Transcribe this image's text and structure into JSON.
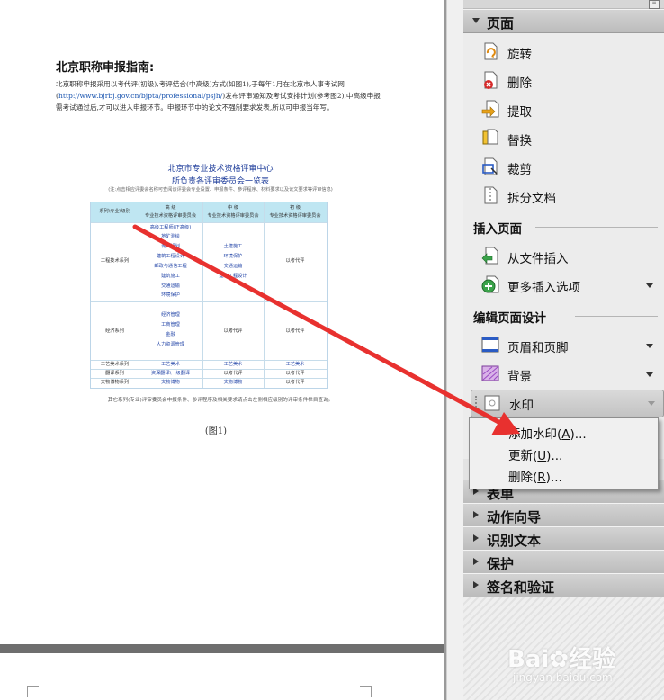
{
  "document": {
    "heading": "北京职称申报指南:",
    "para_1": "北京职称申报采用以考代评(初级),考评结合(中高级)方式(如图1),于每年1月在北京市人事考试网(",
    "para_link": "http://www.bjrbj.gov.cn/bjpta/professional/psjh/",
    "para_2": ")发布评审通知及考试安排计划(参考图2),中高级申报需考试通过后,才可以进入申报环节。申报环节中的论文不强制要求发表,所以可申报当年写。",
    "table_title_1": "北京市专业技术资格评审中心",
    "table_title_2": "所负责各评审委员会一览表",
    "table_note": "(注:点击相应评委会名称可查阅该评委会专业设置、申报条件、参评程序、材料要求以及论文要求等评审信息)",
    "table": {
      "h_col1": "系列\\专业\\级别",
      "h_col2_a": "高    级",
      "h_col2_b": "专业技术资格评审委员会",
      "h_col3_a": "中    级",
      "h_col3_b": "专业技术资格评审委员会",
      "h_col4_a": "初    级",
      "h_col4_b": "专业技术资格评审委员会",
      "row1_series": "工程技术系列",
      "row1_senior": [
        "高级工程师(正高级)",
        "地矿测绘",
        "城乡规划",
        "建筑工程设计",
        "邮政与通信工程",
        "建筑施工",
        "交通运输",
        "环境保护"
      ],
      "row1_mid": [
        "土建施工",
        "环境保护",
        "交通运输",
        "建筑工程设计"
      ],
      "row1_junior": "以考代评",
      "row2_series": "经济系列",
      "row2_senior": [
        "经济管理",
        "工商管理",
        "金融",
        "人力资源管理"
      ],
      "row2_mid": "以考代评",
      "row2_junior": "以考代评",
      "row3_series": "工艺美术系列",
      "row3_senior": "工艺美术",
      "row3_mid": "工艺美术",
      "row3_junior": "工艺美术",
      "row4_series": "翻译系列",
      "row4_senior": "资深翻译\\一级翻译",
      "row4_mid": "以考代评",
      "row4_junior": "以考代评",
      "row5_series": "文物博物系列",
      "row5_senior": "文物博物",
      "row5_mid": "文物博物",
      "row5_junior": "以考代评"
    },
    "table_footer": "其它系列(专业)评审委员会申报条件、参评程序及相关要求请点击左侧相应级别的评审条件栏目查询。",
    "figure_caption": "(图1)"
  },
  "panel": {
    "pages_section": "页面",
    "items_pages": [
      {
        "label": "旋转",
        "icon": "rotate-page-icon"
      },
      {
        "label": "删除",
        "icon": "delete-page-icon"
      },
      {
        "label": "提取",
        "icon": "extract-page-icon"
      },
      {
        "label": "替换",
        "icon": "replace-page-icon"
      },
      {
        "label": "裁剪",
        "icon": "crop-page-icon"
      },
      {
        "label": "拆分文档",
        "icon": "split-document-icon"
      }
    ],
    "insert_subsection": "插入页面",
    "items_insert": [
      {
        "label": "从文件插入",
        "icon": "insert-from-file-icon"
      },
      {
        "label": "更多插入选项",
        "icon": "more-insert-options-icon"
      }
    ],
    "design_subsection": "编辑页面设计",
    "items_design": [
      {
        "label": "页眉和页脚",
        "icon": "header-footer-icon"
      },
      {
        "label": "背景",
        "icon": "background-icon"
      }
    ],
    "watermark_label": "水印",
    "watermark_menu": {
      "add": "添加水印(",
      "add_key": "A",
      "add_tail": ")...",
      "update": "更新(",
      "update_key": "U",
      "update_tail": ")...",
      "delete": "删除(",
      "delete_key": "R",
      "delete_tail": ")..."
    },
    "sections_collapsed": [
      "表单",
      "动作向导",
      "识别文本",
      "保护",
      "签名和验证"
    ]
  },
  "watermark_overlay": {
    "brand": "Bai",
    "brand_tail": "经验",
    "url": "jingyan.baidu.com"
  },
  "colors": {
    "annotation_arrow": "#e8312f",
    "link": "#1a55b0",
    "table_header": "#bfe6f2"
  }
}
